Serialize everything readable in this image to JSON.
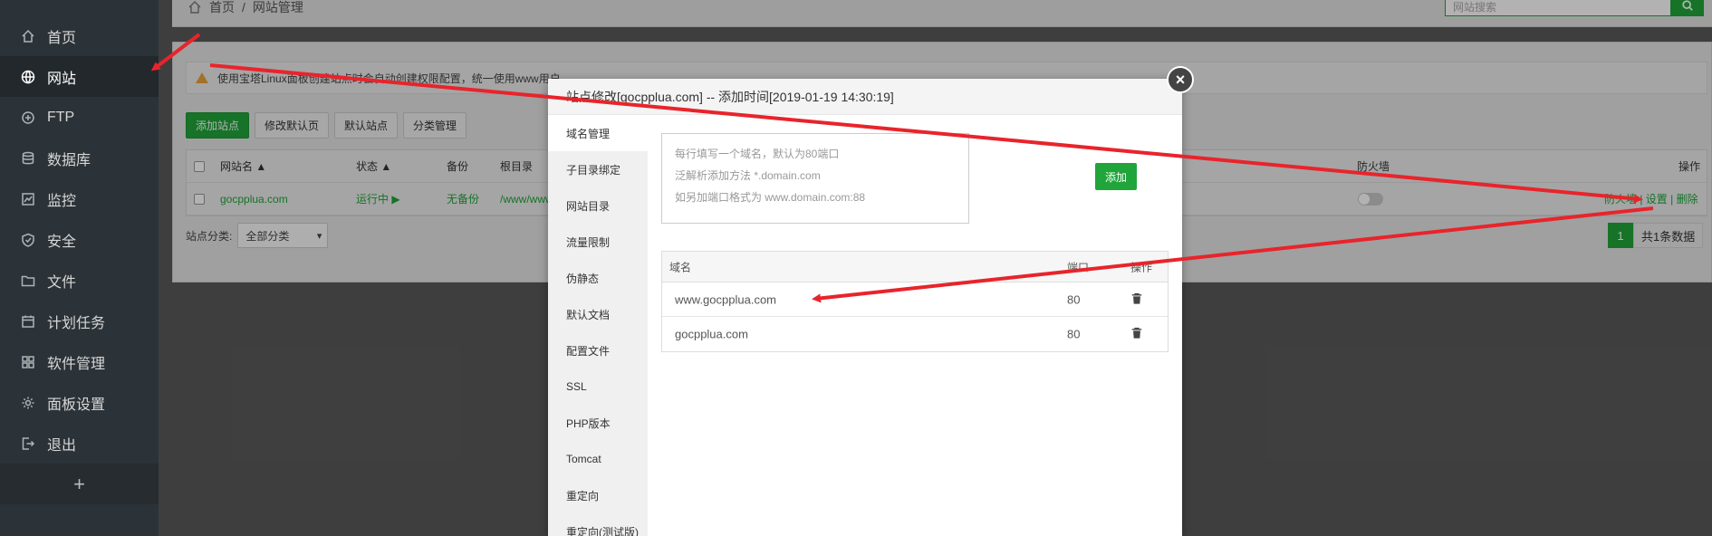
{
  "sidebar": {
    "items": [
      {
        "label": "首页",
        "icon": "home-icon"
      },
      {
        "label": "网站",
        "icon": "globe-icon"
      },
      {
        "label": "FTP",
        "icon": "ftp-icon"
      },
      {
        "label": "数据库",
        "icon": "database-icon"
      },
      {
        "label": "监控",
        "icon": "monitor-icon"
      },
      {
        "label": "安全",
        "icon": "shield-icon"
      },
      {
        "label": "文件",
        "icon": "folder-icon"
      },
      {
        "label": "计划任务",
        "icon": "calendar-icon"
      },
      {
        "label": "软件管理",
        "icon": "grid-icon"
      },
      {
        "label": "面板设置",
        "icon": "gear-icon"
      },
      {
        "label": "退出",
        "icon": "logout-icon"
      }
    ],
    "add_label": "+"
  },
  "breadcrumb": {
    "home": "首页",
    "sep": "/",
    "current": "网站管理"
  },
  "search": {
    "placeholder": "网站搜索"
  },
  "notice": {
    "text": "使用宝塔Linux面板创建站点时会自动创建权限配置，统一使用www用户"
  },
  "toolbar": {
    "add_site": "添加站点",
    "edit_default_page": "修改默认页",
    "default_site": "默认站点",
    "category_manage": "分类管理"
  },
  "table": {
    "headers": {
      "name": "网站名 ▲",
      "status": "状态 ▲",
      "backup": "备份",
      "root": "根目录",
      "firewall": "防火墙",
      "actions": "操作"
    },
    "rows": [
      {
        "name": "gocpplua.com",
        "status": "运行中 ▶",
        "backup": "无备份",
        "root": "/www/wwwroot/",
        "actions": "防火墙 | 设置 | 删除"
      }
    ]
  },
  "category": {
    "label": "站点分类:",
    "selected": "全部分类"
  },
  "pager": {
    "page": "1",
    "total": "共1条数据"
  },
  "modal": {
    "title": "站点修改[gocpplua.com] -- 添加时间[2019-01-19 14:30:19]",
    "close": "×",
    "nav": [
      "域名管理",
      "子目录绑定",
      "网站目录",
      "流量限制",
      "伪静态",
      "默认文档",
      "配置文件",
      "SSL",
      "PHP版本",
      "Tomcat",
      "重定向",
      "重定向(测试版)"
    ],
    "textarea_lines": [
      "每行填写一个域名，默认为80端口",
      "泛解析添加方法 *.domain.com",
      "如另加端口格式为 www.domain.com:88"
    ],
    "add_label": "添加",
    "domain_table": {
      "headers": {
        "domain": "域名",
        "port": "端口",
        "action": "操作"
      },
      "rows": [
        {
          "domain": "www.gocpplua.com",
          "port": "80"
        },
        {
          "domain": "gocpplua.com",
          "port": "80"
        }
      ]
    }
  },
  "colors": {
    "accent": "#20a53a",
    "annotation": "#e8242b"
  }
}
